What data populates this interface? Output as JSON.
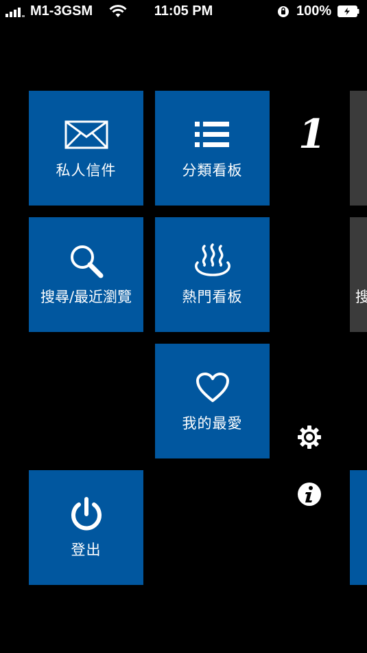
{
  "status_bar": {
    "carrier": "M1-3GSM",
    "time": "11:05 PM",
    "battery_percent": "100%",
    "icons": [
      "signal-bars-icon",
      "wifi-icon",
      "orientation-lock-icon",
      "battery-charging-icon"
    ]
  },
  "colors": {
    "background": "#000000",
    "tile_blue": "#01579f",
    "tile_dark": "#3b3b3b",
    "text": "#ffffff"
  },
  "logo": {
    "text": "1"
  },
  "tiles": [
    {
      "label": "私人信件",
      "icon": "envelope-icon"
    },
    {
      "label": "分類看板",
      "icon": "list-icon"
    },
    {
      "label": "搜尋/最近瀏覽",
      "icon": "magnifier-icon"
    },
    {
      "label": "熱門看板",
      "icon": "hot-spring-icon"
    },
    {
      "label": "我的最愛",
      "icon": "heart-icon"
    },
    {
      "label": "登出",
      "icon": "power-icon"
    }
  ],
  "offscreen_tile": {
    "label_partial": "搜"
  },
  "side_icons": [
    "settings-gear-icon",
    "info-icon"
  ]
}
